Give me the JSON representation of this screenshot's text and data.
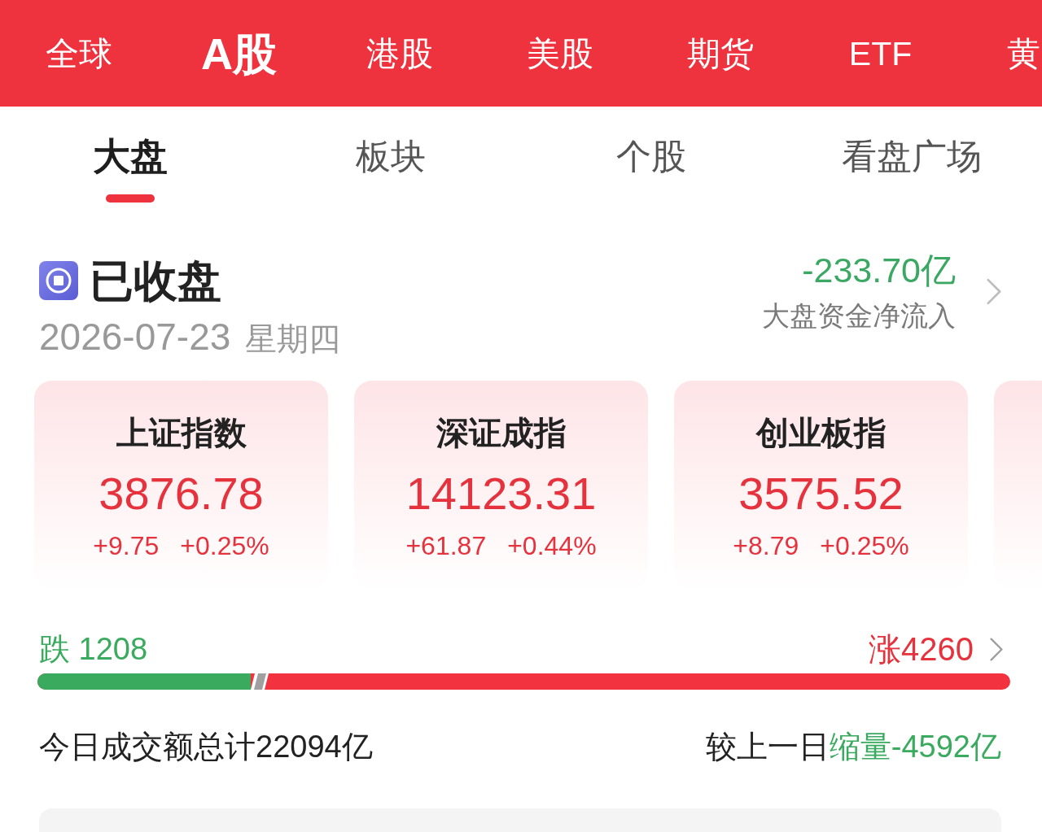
{
  "market_tabs": [
    {
      "label": "全球",
      "selected": false
    },
    {
      "label": "A股",
      "selected": true
    },
    {
      "label": "港股",
      "selected": false
    },
    {
      "label": "美股",
      "selected": false
    },
    {
      "label": "期货",
      "selected": false
    },
    {
      "label": "ETF",
      "selected": false
    },
    {
      "label": "黄",
      "selected": false
    }
  ],
  "sub_tabs": [
    {
      "label": "大盘",
      "selected": true
    },
    {
      "label": "板块",
      "selected": false
    },
    {
      "label": "个股",
      "selected": false
    },
    {
      "label": "看盘广场",
      "selected": false
    }
  ],
  "market_status": {
    "label": "已收盘",
    "date": "2026-07-23",
    "weekday": "星期四"
  },
  "net_inflow": {
    "value": "-233.70亿",
    "label": "大盘资金净流入"
  },
  "indices": [
    {
      "name": "上证指数",
      "value": "3876.78",
      "change": "+9.75",
      "change_pct": "+0.25%"
    },
    {
      "name": "深证成指",
      "value": "14123.31",
      "change": "+61.87",
      "change_pct": "+0.44%"
    },
    {
      "name": "创业板指",
      "value": "3575.52",
      "change": "+8.79",
      "change_pct": "+0.25%"
    }
  ],
  "breadth": {
    "fall": "跌 1208",
    "rise": "涨4260",
    "level": 0.219
  },
  "turnover": {
    "total": "今日成交额总计22094亿",
    "compare_label": "较上一日",
    "compare_value": "缩量-4592亿"
  }
}
